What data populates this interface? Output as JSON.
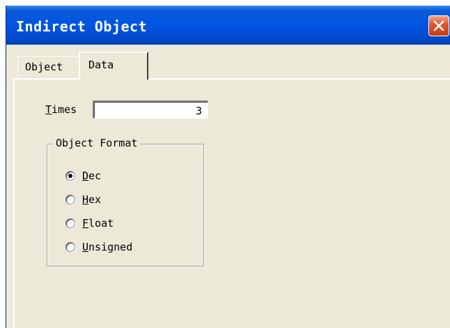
{
  "window": {
    "title": "Indirect Object",
    "close_icon": "close-icon"
  },
  "tabs": [
    {
      "label": "Object",
      "selected": false
    },
    {
      "label": "Data",
      "selected": true
    }
  ],
  "data_tab": {
    "times": {
      "accel": "T",
      "rest": "imes",
      "value": "3"
    },
    "object_format": {
      "legend": "Object Format",
      "options": [
        {
          "accel": "D",
          "rest": "ec",
          "selected": true
        },
        {
          "accel": "H",
          "rest": "ex",
          "selected": false
        },
        {
          "accel": "F",
          "rest": "loat",
          "selected": false
        },
        {
          "accel": "U",
          "rest": "nsigned",
          "selected": false
        }
      ]
    }
  },
  "colors": {
    "titlebar": "#0054e3",
    "dialog_bg": "#ece9d8",
    "close_button": "#e5582f"
  }
}
